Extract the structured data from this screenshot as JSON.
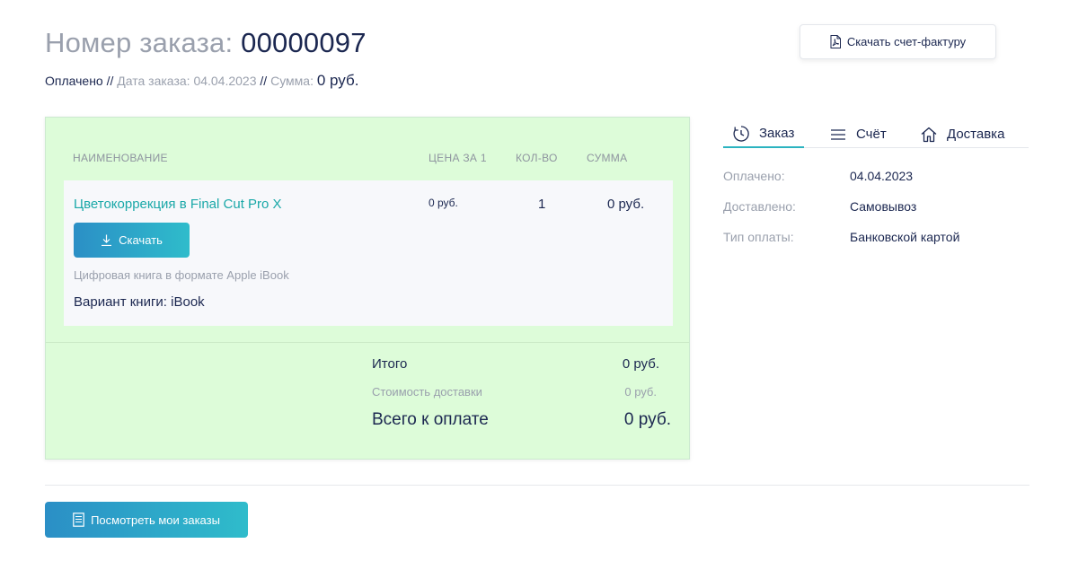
{
  "header": {
    "order_label": "Номер заказа:",
    "order_number": "00000097",
    "status": "Оплачено",
    "separator": "//",
    "date_label": "Дата заказа:",
    "date_value": "04.04.2023",
    "sum_label": "Сумма:",
    "sum_value": "0 руб."
  },
  "invoice_button": {
    "label": "Скачать счет-фактуру",
    "icon": "pdf-file-icon"
  },
  "table": {
    "headers": {
      "name": "НАИМЕНОВАНИЕ",
      "price": "ЦЕНА ЗА 1",
      "qty": "КОЛ-ВО",
      "sum": "СУММА"
    },
    "items": [
      {
        "name": "Цветокоррекция в Final Cut Pro X",
        "price": "0 руб.",
        "qty": "1",
        "sum": "0 руб.",
        "download_label": "Скачать",
        "description": "Цифровая книга в формате Apple iBook",
        "variant": "Вариант книги: iBook"
      }
    ]
  },
  "totals": {
    "subtotal_label": "Итого",
    "subtotal_value": "0 руб.",
    "delivery_label": "Стоимость доставки",
    "delivery_value": "0 руб.",
    "grand_label": "Всего к оплате",
    "grand_value": "0 руб."
  },
  "tabs": [
    {
      "label": "Заказ",
      "icon": "clock-icon",
      "active": true
    },
    {
      "label": "Счёт",
      "icon": "menu-lines-icon",
      "active": false
    },
    {
      "label": "Доставка",
      "icon": "home-icon",
      "active": false
    }
  ],
  "info": [
    {
      "label": "Оплачено:",
      "value": "04.04.2023"
    },
    {
      "label": "Доставлено:",
      "value": "Самовывоз"
    },
    {
      "label": "Тип оплаты:",
      "value": "Банковской картой"
    }
  ],
  "footer": {
    "my_orders_label": "Посмотреть мои заказы",
    "icon": "document-icon"
  },
  "colors": {
    "accent_teal": "#2bb3c0",
    "button_gradient_start": "#2b8fc6",
    "button_gradient_end": "#2fbccb",
    "card_background": "#ddfcd9",
    "text_dark": "#1b2750",
    "text_muted": "#9aa0ad"
  }
}
